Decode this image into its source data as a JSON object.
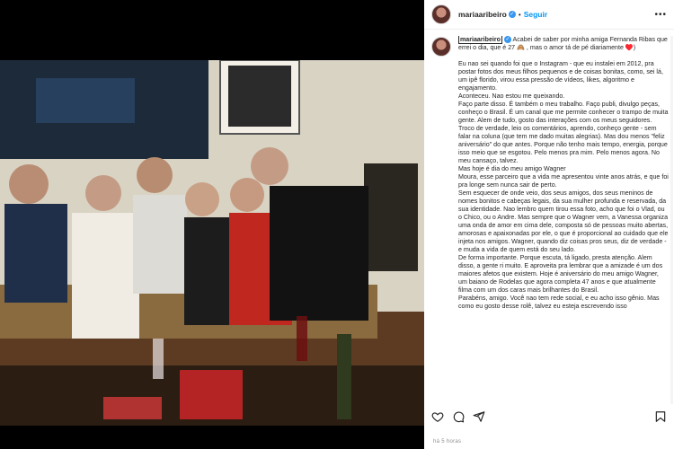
{
  "post": {
    "username": "mariaaribeiro",
    "separator": "•",
    "follow_label": "Seguir",
    "more_label": "•••",
    "caption_user": "mariaaribeiro",
    "caption_intro": " Acabei de saber por minha amiga Fernanda Ribas que errei o dia, que é 27 🙈 , mas o amor tá de pé diariamente ♥️)",
    "caption_lines": [
      "Eu nao sei quando foi que o Instagram - que eu instalei em 2012, pra postar fotos dos meus filhos pequenos e de coisas bonitas, como, sei lá, um ipê florido, virou essa pressão de vídeos, likes, algoritmo e engajamento.",
      "Aconteceu. Nao estou me queixando.",
      "Faço parte disso. É também o meu trabalho. Faço publi, divulgo peças, conheço o Brasil. É um canal que me permite conhecer o trampo de muita gente. Alem de tudo, gosto das interações com os meus seguidores. Troco de verdade, leio os comentários, aprendo, conheço gente - sem falar na coluna (que tem me dado muitas alegrias). Mas dou menos \"feliz aniversário\" do que antes. Porque não tenho mais tempo, energia, porque isso meio que se esgotou. Pelo menos pra mim. Pelo menos agora. No meu cansaço, talvez.",
      "Mas hoje é dia do meu amigo Wagner",
      "Moura, esse parceiro que a vida me apresentou vinte anos atrás, e que foi pra longe sem nunca sair de perto.",
      "Sem esquecer de onde veio, dos seus amigos, dos seus meninos de nomes bonitos e cabeças legais, da sua mulher profunda e reservada, da sua identidade. Nao lembro quem tirou essa foto, acho que foi o Vlad, ou o Chico, ou o Andre. Mas sempre que o Wagner vem, a Vanessa organiza uma onda de amor em cima dele, composta só de pessoas muito abertas, amorosas e apaixonadas por ele, o que é proporcional ao cuidado que ele injeta nos amigos. Wagner, quando diz coisas pros seus, diz de verdade - e muda a vida de quem está do seu lado.",
      "De forma importante. Porque escuta, tá ligado, presta atenção. Alem disso, a gente ri muito. E aproveita pra lembrar que a amizade é um dos maiores afetos que existem. Hoje é aniversário do meu amigo Wagner, um baiano de Rodelas que agora completa 47 anos e que atualmente filma com um dos caras mais brilhantes do Brasil.",
      "Parabéns, amigo. Você nao tem rede social, e eu acho isso gênio. Mas como eu gosto desse rolê, talvez eu esteja escrevendo isso"
    ],
    "time_label": "há 5 horas"
  },
  "icons": {
    "like": "heart-icon",
    "comment": "comment-icon",
    "share": "share-icon",
    "save": "bookmark-icon"
  },
  "colors": {
    "follow": "#0095f6",
    "verified": "#3897f0",
    "text": "#262626",
    "muted": "#8e8e8e"
  }
}
